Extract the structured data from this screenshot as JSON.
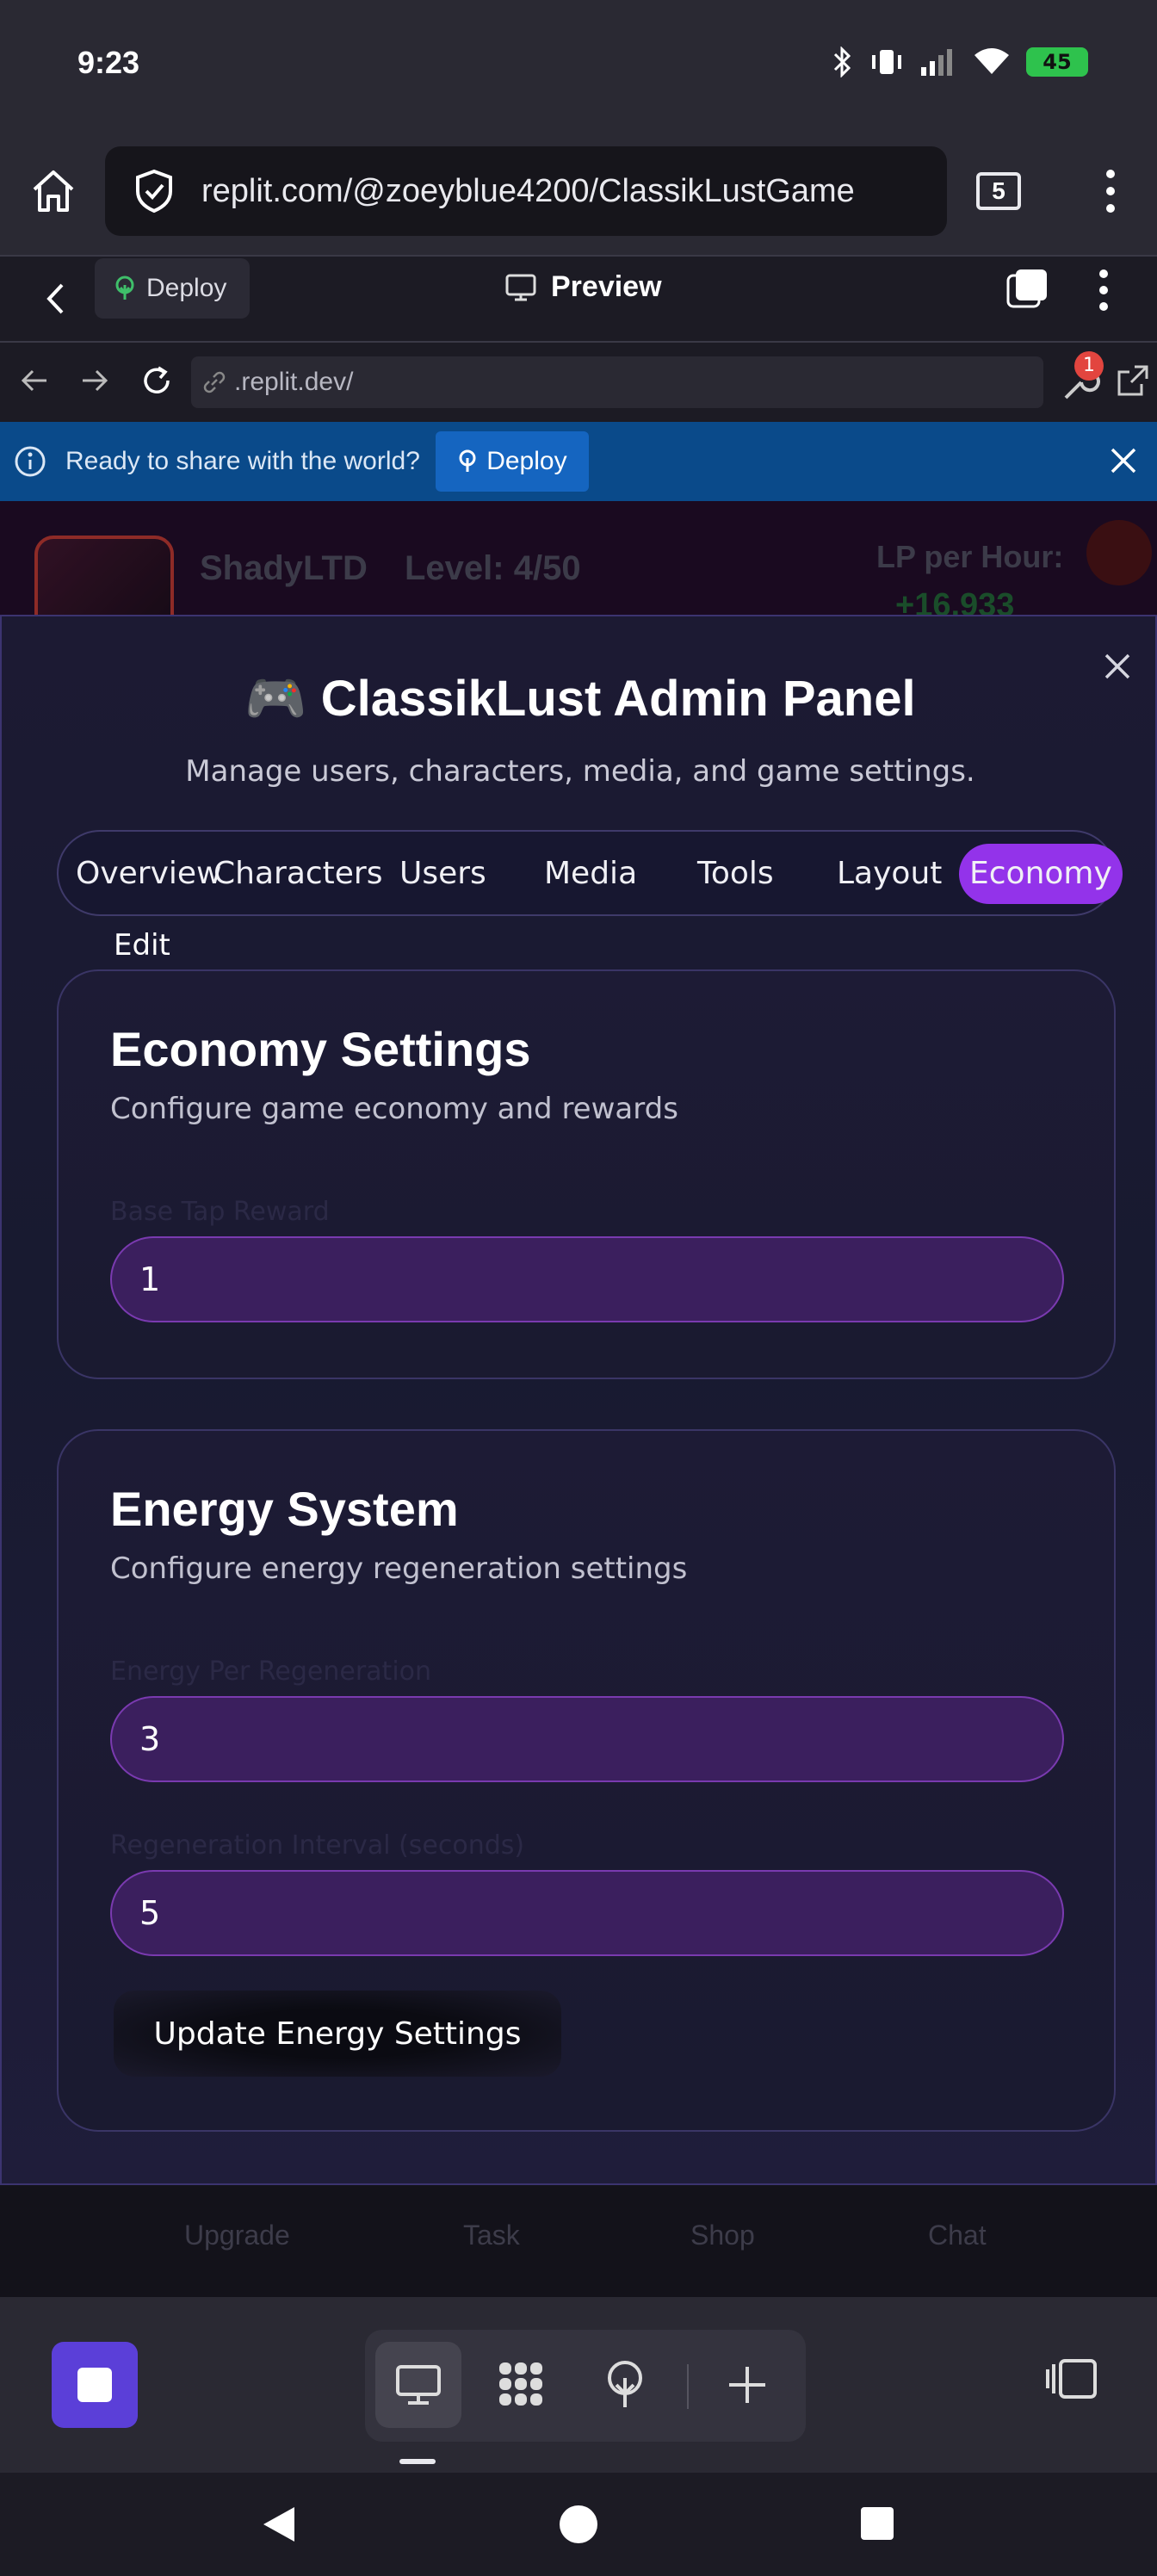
{
  "status": {
    "time": "9:23",
    "battery": "45"
  },
  "browser": {
    "url": "replit.com/@zoeyblue4200/ClassikLustGame",
    "tab_count": "5"
  },
  "replit_header": {
    "deploy_label": "Deploy",
    "view_title": "Preview"
  },
  "preview_toolbar": {
    "address": ".replit.dev/",
    "notification_count": "1"
  },
  "banner": {
    "message": "Ready to share with the world?",
    "deploy_label": "Deploy"
  },
  "game_header": {
    "username": "ShadyLTD",
    "level": "Level: 4/50",
    "lp_label": "LP per Hour:",
    "lp_value": "+16,933"
  },
  "modal": {
    "title": "🎮 ClassikLust Admin Panel",
    "subtitle": "Manage users, characters, media, and game settings.",
    "tabs": [
      {
        "label": "Overview"
      },
      {
        "label": "Characters"
      },
      {
        "label": "Users"
      },
      {
        "label": "Media"
      },
      {
        "label": "Tools"
      },
      {
        "label": "Layout"
      },
      {
        "label": "Economy"
      }
    ],
    "tab_overflow": "Edit",
    "active_tab": "Economy",
    "economy": {
      "title": "Economy Settings",
      "description": "Configure game economy and rewards",
      "base_tap_label": "Base Tap Reward",
      "base_tap_value": "1"
    },
    "energy": {
      "title": "Energy System",
      "description": "Configure energy regeneration settings",
      "per_regen_label": "Energy Per Regeneration",
      "per_regen_value": "3",
      "interval_label": "Regeneration Interval (seconds)",
      "interval_value": "5",
      "update_button": "Update Energy Settings"
    }
  },
  "game_nav": {
    "items": [
      "Upgrade",
      "Task",
      "Shop",
      "Chat"
    ]
  },
  "colors": {
    "accent": "#9333ea",
    "banner": "#0a4a8a",
    "field": "#3b1f5e"
  }
}
